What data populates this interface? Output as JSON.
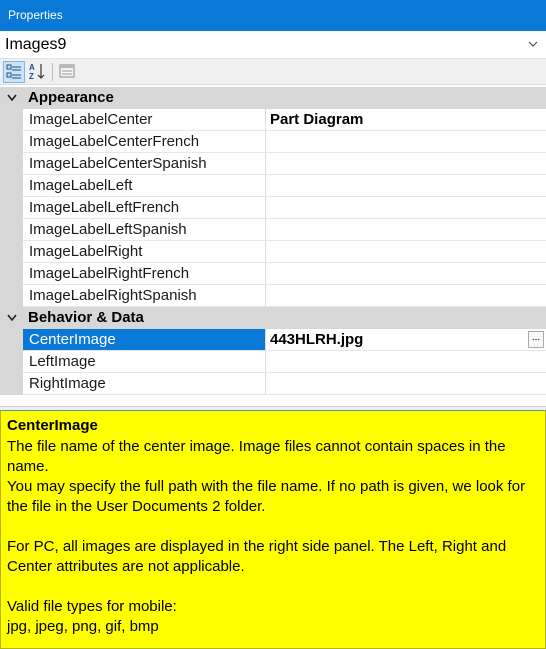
{
  "window": {
    "title": "Properties"
  },
  "object_selector": {
    "value": "Images9"
  },
  "toolbar": {
    "categorized_icon": "categorized-icon",
    "alphabetical_icon": "sort-alpha-icon",
    "property_pages_icon": "property-pages-icon"
  },
  "categories": [
    {
      "label": "Appearance",
      "rows": [
        {
          "name": "ImageLabelCenter",
          "value": "Part Diagram"
        },
        {
          "name": "ImageLabelCenterFrench",
          "value": ""
        },
        {
          "name": "ImageLabelCenterSpanish",
          "value": ""
        },
        {
          "name": "ImageLabelLeft",
          "value": ""
        },
        {
          "name": "ImageLabelLeftFrench",
          "value": ""
        },
        {
          "name": "ImageLabelLeftSpanish",
          "value": ""
        },
        {
          "name": "ImageLabelRight",
          "value": ""
        },
        {
          "name": "ImageLabelRightFrench",
          "value": ""
        },
        {
          "name": "ImageLabelRightSpanish",
          "value": ""
        }
      ]
    },
    {
      "label": "Behavior & Data",
      "rows": [
        {
          "name": "CenterImage",
          "value": "443HLRH.jpg",
          "ellipsis": "..."
        },
        {
          "name": "LeftImage",
          "value": ""
        },
        {
          "name": "RightImage",
          "value": ""
        }
      ]
    }
  ],
  "help": {
    "title": "CenterImage",
    "lines": [
      "The file name of the center image. Image files cannot contain spaces in the name.",
      "You may specify the full path with the file name.  If no path is given, we look for the file in the User Documents 2 folder.",
      "",
      "For PC, all images are displayed in the right side panel. The Left, Right and Center attributes are not applicable.",
      "",
      "Valid file types for mobile:",
      "jpg, jpeg, png, gif, bmp"
    ]
  },
  "colors": {
    "accent": "#0a78d7",
    "help_bg": "#ffff00",
    "category_bg": "#d7d7d7"
  }
}
